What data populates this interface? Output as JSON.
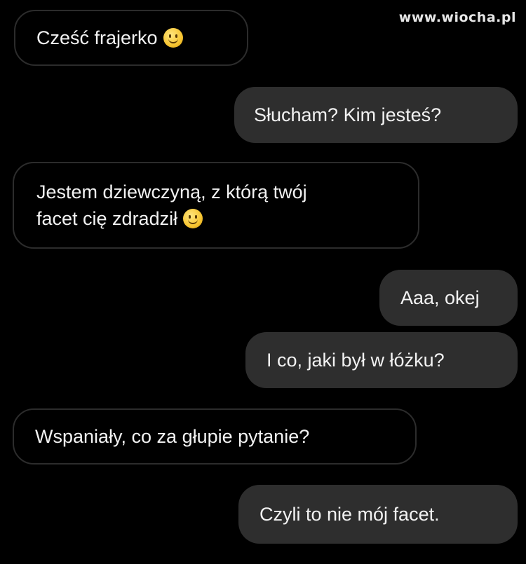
{
  "watermark": "www.wiocha.pl",
  "messages": [
    {
      "direction": "incoming",
      "text": "Cześć frajerko",
      "emoji": "smile-emoji-icon"
    },
    {
      "direction": "outgoing",
      "text": "Słucham? Kim jesteś?"
    },
    {
      "direction": "incoming",
      "line1": "Jestem dziewczyną, z którą twój",
      "line2": "facet cię zdradził",
      "emoji": "smile-emoji-icon"
    },
    {
      "direction": "outgoing",
      "text": "Aaa, okej"
    },
    {
      "direction": "outgoing",
      "text": "I co, jaki był w łóżku?"
    },
    {
      "direction": "incoming",
      "text": "Wspaniały, co za głupie pytanie?"
    },
    {
      "direction": "outgoing",
      "text": "Czyli to nie mój facet."
    }
  ],
  "colors": {
    "background": "#000000",
    "outgoing_bubble": "#2e2e2e",
    "incoming_border": "#2c2c2c",
    "text": "#f2f2f2",
    "emoji": "#f7c531"
  }
}
